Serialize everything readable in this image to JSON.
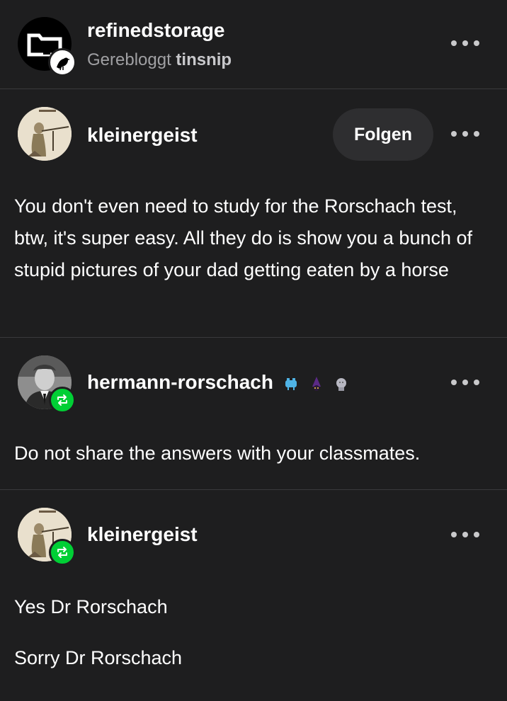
{
  "header": {
    "blog_name": "refinedstorage",
    "reblogged_label": "Gerebloggt",
    "reblogged_from": "tinsnip"
  },
  "posts": [
    {
      "author": "kleinergeist",
      "follow_label": "Folgen",
      "text": "You don't even need to study for the Rorschach test, btw, it's super easy. All they do is show you a bunch of stupid pictures of your dad getting eaten by a horse"
    },
    {
      "author": "hermann-rorschach",
      "badges": [
        "crab-badge-icon",
        "wizard-badge-icon",
        "statue-badge-icon"
      ],
      "text": "Do not share the answers with your classmates."
    },
    {
      "author": "kleinergeist",
      "text_lines": [
        "Yes Dr Rorschach",
        "Sorry Dr Rorschach"
      ]
    }
  ],
  "colors": {
    "background": "#1e1e1f",
    "reblog_badge": "#00cf35",
    "muted_text": "#a0a0a3"
  }
}
